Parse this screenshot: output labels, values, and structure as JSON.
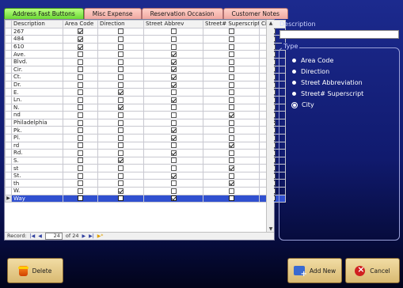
{
  "tabs": [
    {
      "label": "Address Fast Buttons",
      "active": true
    },
    {
      "label": "Misc Expense",
      "active": false
    },
    {
      "label": "Reservation Occasion",
      "active": false
    },
    {
      "label": "Customer Notes",
      "active": false
    }
  ],
  "grid": {
    "columns": [
      "Description",
      "Area Code",
      "Direction",
      "Street Abbrev",
      "Street# Superscript",
      "City"
    ],
    "rows": [
      {
        "description": "267",
        "area_code": true,
        "direction": false,
        "street_abbrev": false,
        "superscript": false,
        "city": false
      },
      {
        "description": "484",
        "area_code": true,
        "direction": false,
        "street_abbrev": false,
        "superscript": false,
        "city": false
      },
      {
        "description": "610",
        "area_code": true,
        "direction": false,
        "street_abbrev": false,
        "superscript": false,
        "city": false
      },
      {
        "description": "Ave.",
        "area_code": false,
        "direction": false,
        "street_abbrev": true,
        "superscript": false,
        "city": false
      },
      {
        "description": "Blvd.",
        "area_code": false,
        "direction": false,
        "street_abbrev": true,
        "superscript": false,
        "city": false
      },
      {
        "description": "Cir.",
        "area_code": false,
        "direction": false,
        "street_abbrev": true,
        "superscript": false,
        "city": false
      },
      {
        "description": "Ct.",
        "area_code": false,
        "direction": false,
        "street_abbrev": true,
        "superscript": false,
        "city": false
      },
      {
        "description": "Dr.",
        "area_code": false,
        "direction": false,
        "street_abbrev": true,
        "superscript": false,
        "city": false
      },
      {
        "description": "E.",
        "area_code": false,
        "direction": true,
        "street_abbrev": false,
        "superscript": false,
        "city": false
      },
      {
        "description": "Ln.",
        "area_code": false,
        "direction": false,
        "street_abbrev": true,
        "superscript": false,
        "city": false
      },
      {
        "description": "N.",
        "area_code": false,
        "direction": true,
        "street_abbrev": false,
        "superscript": false,
        "city": false
      },
      {
        "description": "nd",
        "area_code": false,
        "direction": false,
        "street_abbrev": false,
        "superscript": true,
        "city": false
      },
      {
        "description": "Philadelphia",
        "area_code": false,
        "direction": false,
        "street_abbrev": false,
        "superscript": false,
        "city": true
      },
      {
        "description": "Pk.",
        "area_code": false,
        "direction": false,
        "street_abbrev": true,
        "superscript": false,
        "city": false
      },
      {
        "description": "Pl.",
        "area_code": false,
        "direction": false,
        "street_abbrev": true,
        "superscript": false,
        "city": false
      },
      {
        "description": "rd",
        "area_code": false,
        "direction": false,
        "street_abbrev": false,
        "superscript": true,
        "city": false
      },
      {
        "description": "Rd.",
        "area_code": false,
        "direction": false,
        "street_abbrev": true,
        "superscript": false,
        "city": false
      },
      {
        "description": "S.",
        "area_code": false,
        "direction": true,
        "street_abbrev": false,
        "superscript": false,
        "city": false
      },
      {
        "description": "st",
        "area_code": false,
        "direction": false,
        "street_abbrev": false,
        "superscript": true,
        "city": false
      },
      {
        "description": "St.",
        "area_code": false,
        "direction": false,
        "street_abbrev": true,
        "superscript": false,
        "city": false
      },
      {
        "description": "th",
        "area_code": false,
        "direction": false,
        "street_abbrev": false,
        "superscript": true,
        "city": false
      },
      {
        "description": "W.",
        "area_code": false,
        "direction": true,
        "street_abbrev": false,
        "superscript": false,
        "city": false
      },
      {
        "description": "Way",
        "area_code": false,
        "direction": false,
        "street_abbrev": true,
        "superscript": false,
        "city": false,
        "current": true
      }
    ]
  },
  "record_nav": {
    "label": "Record:",
    "first": "|◀",
    "prev": "◀",
    "current": "24",
    "of_text": "of 24",
    "next": "▶",
    "last": "▶|",
    "new": "▶*"
  },
  "right_panel": {
    "description_label": "Description",
    "description_value": "",
    "type_label": "Type",
    "options": [
      {
        "label": "Area Code",
        "selected": false
      },
      {
        "label": "Direction",
        "selected": false
      },
      {
        "label": "Street Abbreviation",
        "selected": false
      },
      {
        "label": "Street# Superscript",
        "selected": false
      },
      {
        "label": "City",
        "selected": true
      }
    ]
  },
  "buttons": {
    "delete": "Delete",
    "add_new": "Add New",
    "cancel": "Cancel"
  },
  "icons": {
    "delete": "trash-icon",
    "add_new": "add-record-icon",
    "cancel": "cancel-icon"
  }
}
